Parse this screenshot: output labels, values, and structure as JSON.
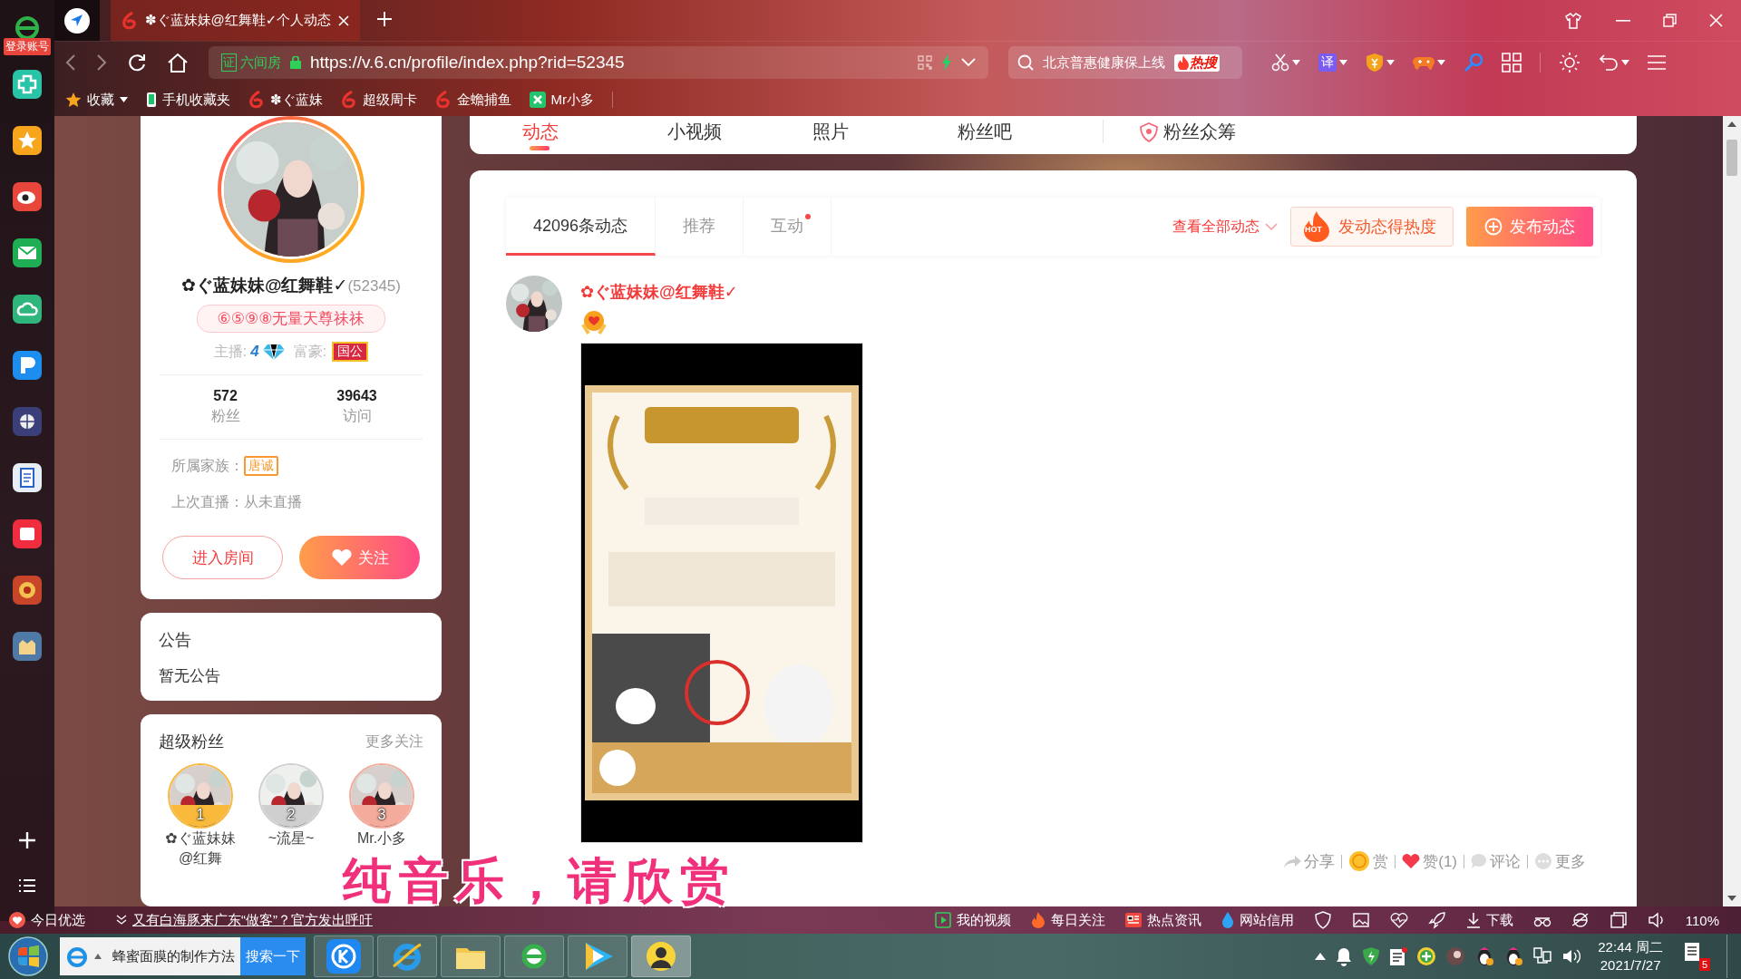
{
  "dock": {
    "login_label": "登录账号"
  },
  "browser": {
    "tabs": [
      {
        "title": "✽ぐ蓝妹妹@红舞鞋✓个人动态",
        "selected": true
      }
    ],
    "address": {
      "cert_label": "证",
      "site_label": "六间房",
      "url": "https://v.6.cn/profile/index.php?rid=52345"
    },
    "search": {
      "text": "北京普惠健康保上线",
      "badge": "热搜"
    },
    "translate_label": "译",
    "bookmarks": [
      {
        "kind": "star",
        "label": "收藏"
      },
      {
        "kind": "phone",
        "label": "手机收藏夹"
      },
      {
        "kind": "six",
        "label": "✽ぐ蓝妹"
      },
      {
        "kind": "six",
        "label": "超级周卡"
      },
      {
        "kind": "six",
        "label": "金蟾捕鱼"
      },
      {
        "kind": "app",
        "label": "Mr小多"
      }
    ]
  },
  "profile": {
    "name": "✿ぐ蓝妹妹@红舞鞋✓",
    "room_id": "(52345)",
    "title_badge": "⑥⑤⑨⑧无量天尊祙祙",
    "anchor_label": "主播:",
    "anchor_level": "4",
    "rich_label": "富豪:",
    "rich_badge": "国公",
    "stats": [
      {
        "value": "572",
        "label": "粉丝"
      },
      {
        "value": "39643",
        "label": "访问"
      }
    ],
    "family_label": "所属家族：",
    "family": "唐诚",
    "last_live_label": "上次直播：",
    "last_live": "从未直播",
    "enter_button": "进入房间",
    "follow_button": "关注"
  },
  "notice": {
    "title": "公告",
    "text": "暂无公告"
  },
  "super_fans": {
    "title": "超级粉丝",
    "more": "更多关注",
    "fans": [
      {
        "rank": "1",
        "name": "✿ぐ蓝妹妹@红舞",
        "color": "#f9b93a"
      },
      {
        "rank": "2",
        "name": "~流星~",
        "color": "#cfcfcf"
      },
      {
        "rank": "3",
        "name": "Mr.小多",
        "color": "#f5ab9b"
      }
    ]
  },
  "nav_tabs": [
    {
      "label": "动态",
      "selected": true
    },
    {
      "label": "小视频",
      "selected": false
    },
    {
      "label": "照片",
      "selected": false
    },
    {
      "label": "粉丝吧",
      "selected": false
    },
    {
      "label": "粉丝众筹",
      "selected": false
    }
  ],
  "feed": {
    "tabs": [
      {
        "label": "42096条动态",
        "selected": true,
        "unread": false
      },
      {
        "label": "推荐",
        "selected": false,
        "unread": false
      },
      {
        "label": "互动",
        "selected": false,
        "unread": true
      }
    ],
    "filter": "查看全部动态",
    "hot_button": "发动态得热度",
    "hot_badge": "HOT",
    "publish_button": "发布动态",
    "post": {
      "author": "✿ぐ蓝妹妹@红舞鞋✓",
      "actions": [
        {
          "kind": "share",
          "label": "分享"
        },
        {
          "kind": "reward",
          "label": "赏"
        },
        {
          "kind": "like",
          "label": "赞(1)"
        },
        {
          "kind": "comment",
          "label": "评论"
        },
        {
          "kind": "more",
          "label": "更多"
        }
      ]
    }
  },
  "caption": "纯音乐，请欣赏",
  "status_bar": {
    "pick": "今日优选",
    "news": "又有白海豚来广东“做客”？官方发出呼吁",
    "links": [
      {
        "kind": "video",
        "label": "我的视频"
      },
      {
        "kind": "fire",
        "label": "每日关注"
      },
      {
        "kind": "news",
        "label": "热点资讯"
      },
      {
        "kind": "credit",
        "label": "网站信用"
      }
    ],
    "download": "下载",
    "zoom": "110%"
  },
  "taskbar": {
    "search_value": "蜂蜜面膜的制作方法",
    "search_button": "搜索一下",
    "time": "22:44 周二",
    "date": "2021/7/27",
    "notifications": "5"
  }
}
